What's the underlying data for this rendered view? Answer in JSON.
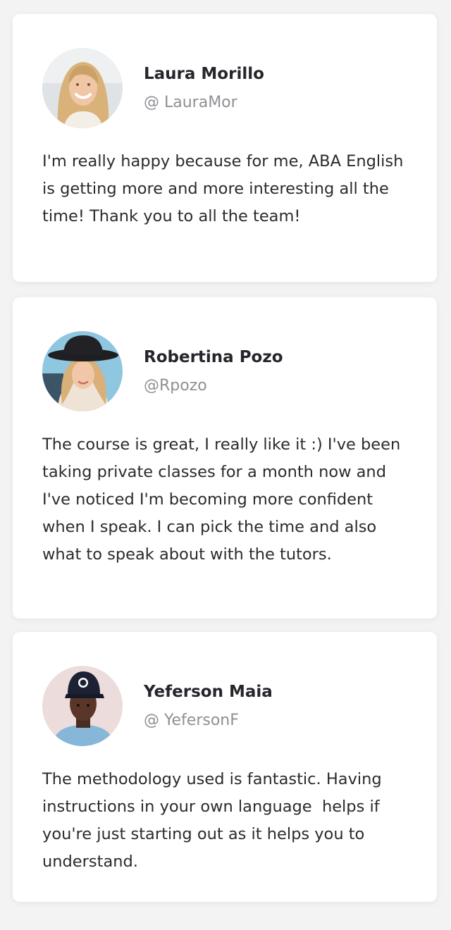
{
  "testimonials": [
    {
      "name": "Laura Morillo",
      "handle": "@ LauraMor",
      "text": "I'm really happy because for me, ABA English is getting more and more interesting all the time! Thank you to all the team!",
      "avatar_icon": "woman-blonde-portrait-icon"
    },
    {
      "name": "Robertina Pozo",
      "handle": "@Rpozo",
      "text": "The course is great, I really like it :) I've been taking private classes for a month now and I've noticed I'm becoming more confident when I speak. I can pick the time and also what to speak about with the tutors.",
      "avatar_icon": "woman-black-hat-portrait-icon"
    },
    {
      "name": "Yeferson Maia",
      "handle": "@ YefersonF",
      "text": "The methodology used is fantastic. Having instructions in your own language  helps if you're just starting out as it helps you to understand.",
      "avatar_icon": "man-cap-portrait-icon"
    }
  ],
  "colors": {
    "background": "#f3f3f4",
    "card": "#ffffff",
    "name": "#25252b",
    "handle": "#8f8f95",
    "text": "#2b2b2f"
  }
}
